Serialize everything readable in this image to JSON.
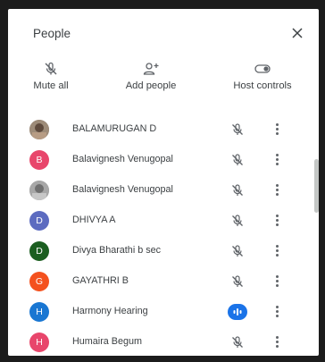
{
  "panel": {
    "title": "People",
    "close_icon": "close-icon"
  },
  "actions": [
    {
      "label": "Mute all",
      "icon": "mic-off-icon"
    },
    {
      "label": "Add people",
      "icon": "person-add-icon"
    },
    {
      "label": "Host controls",
      "icon": "toggle-icon"
    }
  ],
  "participants": [
    {
      "name": "BALAMURUGAN D",
      "avatar_type": "photo",
      "avatar_color": "#8a7b6a",
      "mic": "muted"
    },
    {
      "name": "Balavignesh Venugopal",
      "avatar_letter": "B",
      "avatar_color": "#e8466b",
      "mic": "muted"
    },
    {
      "name": "Balavignesh Venugopal",
      "avatar_type": "photo",
      "avatar_color": "#9a9a9a",
      "mic": "muted"
    },
    {
      "name": "DHIVYA A",
      "avatar_letter": "D",
      "avatar_color": "#5c6bc0",
      "mic": "muted"
    },
    {
      "name": "Divya Bharathi b sec",
      "avatar_letter": "D",
      "avatar_color": "#1b5e20",
      "mic": "muted"
    },
    {
      "name": "GAYATHRI B",
      "avatar_letter": "G",
      "avatar_color": "#f4511e",
      "mic": "muted"
    },
    {
      "name": "Harmony Hearing",
      "avatar_letter": "H",
      "avatar_color": "#1976d2",
      "mic": "speaking"
    },
    {
      "name": "Humaira Begum",
      "avatar_letter": "H",
      "avatar_color": "#e8466b",
      "mic": "muted"
    }
  ],
  "colors": {
    "speaking": "#1a73e8",
    "icon": "#5f6368"
  }
}
